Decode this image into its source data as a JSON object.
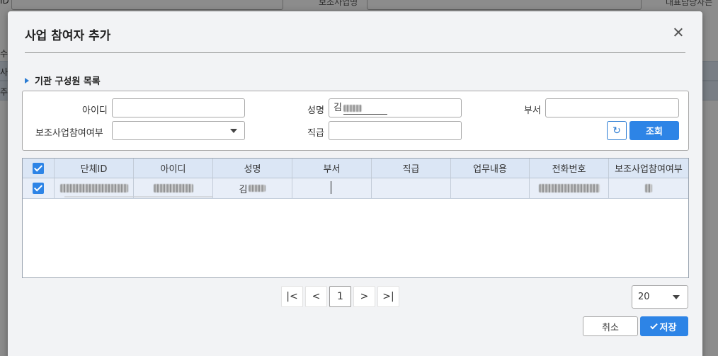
{
  "background": {
    "label_id": "ID",
    "label_business": "보조사업명",
    "label_rep": "대표담당자는",
    "left_stub_1": "수 조",
    "left_stub_2": "사",
    "left_stub_3": "주"
  },
  "modal": {
    "title": "사업 참여자 추가",
    "section_title": "기관 구성원 목록"
  },
  "search": {
    "id_label": "아이디",
    "id_value": "",
    "name_label": "성명",
    "name_value": "김",
    "dept_label": "부서",
    "dept_value": "",
    "participation_label": "보조사업참여여부",
    "participation_value": "",
    "rank_label": "직급",
    "rank_value": "",
    "search_button": "조회",
    "reset_icon": "refresh-icon"
  },
  "grid": {
    "columns": [
      "단체ID",
      "아이디",
      "성명",
      "부서",
      "직급",
      "업무내용",
      "전화번호",
      "보조사업참여여부"
    ],
    "rows": [
      {
        "checked": true,
        "org_id": "",
        "user_id": "",
        "name": "김",
        "dept": "",
        "rank": "",
        "work": "",
        "phone": "",
        "participation": ""
      }
    ]
  },
  "pager": {
    "first": "|<",
    "prev": "<",
    "current": "1",
    "next": ">",
    "last": ">|",
    "page_size": "20"
  },
  "footer": {
    "cancel": "취소",
    "save": "저장"
  },
  "colors": {
    "accent": "#2d84e6",
    "header_bg": "#dbe6f5",
    "row_bg": "#e8eef8"
  }
}
